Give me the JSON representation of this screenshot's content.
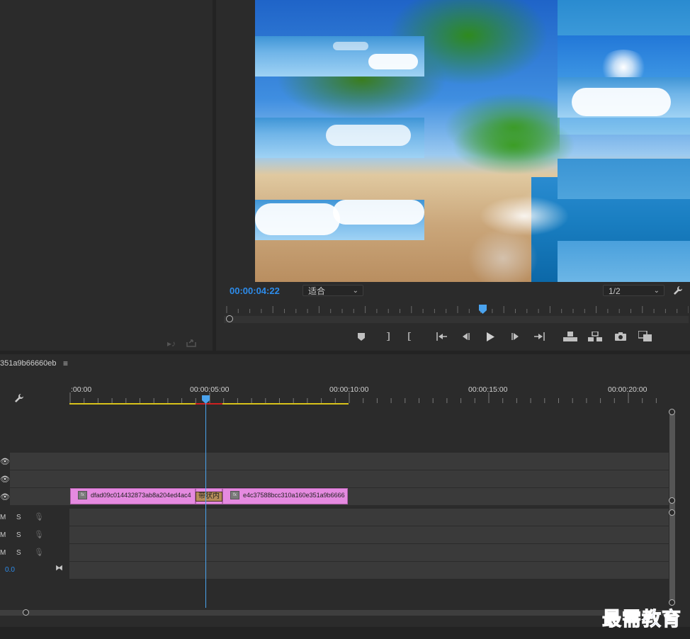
{
  "program": {
    "timecode": "00:00:04:22",
    "zoom_value": "适合",
    "resolution_value": "1/2"
  },
  "timeline": {
    "sequence_name": "351a9b66660eb",
    "ruler_labels": [
      ":00:00",
      "00:00:05:00",
      "00:00:10:00",
      "00:00:15:00",
      "00:00:20:00"
    ],
    "audio_m_label": "M",
    "audio_s_label": "S",
    "master_value": "0.0",
    "clips": [
      {
        "name": "dfad09c014432873ab8a204ed4ac4"
      },
      {
        "name": "e4c37588bcc310a160e351a9b6666"
      }
    ],
    "transition_label": "带状内",
    "fx_badge": "fx"
  },
  "watermark": "最需教育",
  "colors": {
    "accent_blue": "#2d8ceb",
    "clip_pink": "#e58ae0",
    "work_area_yellow": "#d8c21a",
    "render_red": "#d02020"
  }
}
